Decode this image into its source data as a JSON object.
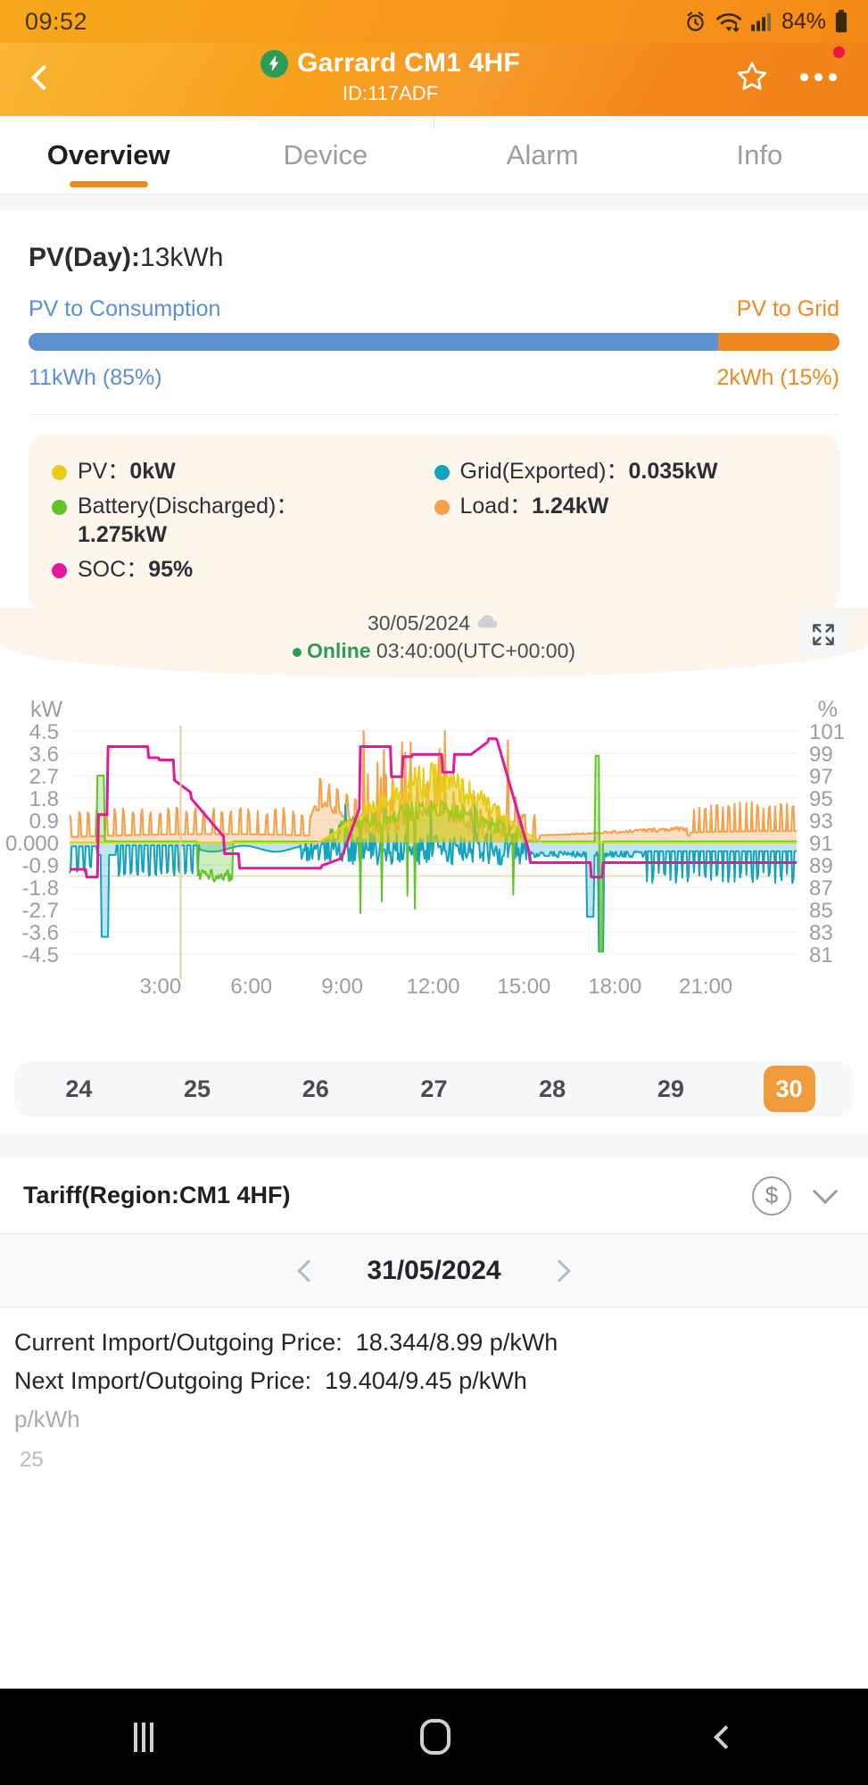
{
  "statusbar": {
    "time": "09:52",
    "battery_pct": "84%",
    "icons": [
      "alarm-icon",
      "wifi-icon",
      "signal-icon",
      "battery-icon"
    ]
  },
  "appbar": {
    "back_icon": "chevron-left-icon",
    "bolt_icon": "⚡",
    "title": "Garrard CM1 4HF",
    "device_id": "ID:117ADF",
    "favorite_icon": "star-outline-icon",
    "more_icon": "more-horizontal-icon",
    "accent": "#f2811a"
  },
  "tabs": [
    {
      "label": "Overview",
      "active": true
    },
    {
      "label": "Device",
      "active": false
    },
    {
      "label": "Alarm",
      "active": false
    },
    {
      "label": "Info",
      "active": false
    }
  ],
  "pv_summary": {
    "title_label": "PV(Day):",
    "title_value": "13kWh",
    "left_label": "PV to Consumption",
    "right_label": "PV to Grid",
    "left_value": "11kWh (85%)",
    "right_value": "2kWh (15%)",
    "left_pct": 85,
    "right_pct": 15,
    "left_color": "#5e90cf",
    "right_color": "#ee8622"
  },
  "legend": {
    "left": [
      {
        "name": "PV",
        "separator": "：",
        "value": "0kW",
        "color": "#e8cc17",
        "dot": "pv-dot"
      },
      {
        "name": "Battery(Discharged)",
        "separator": "：",
        "value": "1.275kW",
        "color": "#63c32c",
        "dot": "battery-dot",
        "wrap": true
      },
      {
        "name": "SOC",
        "separator": "：",
        "value": "95%",
        "color": "#e3189a",
        "dot": "soc-dot"
      }
    ],
    "right": [
      {
        "name": "Grid(Exported)",
        "separator": "：",
        "value": "0.035kW",
        "color": "#13a3bd",
        "dot": "grid-dot"
      },
      {
        "name": "Load",
        "separator": "：",
        "value": "1.24kW",
        "color": "#f5a04a",
        "dot": "load-dot"
      }
    ]
  },
  "status_strip": {
    "date": "30/05/2024",
    "weather_icon": "cloud-icon",
    "status_dot": "online-dot",
    "status": "Online",
    "timestamp": "03:40:00(UTC+00:00)",
    "expand_icon": "expand-fullscreen-icon"
  },
  "chart_data": {
    "type": "line",
    "title": "",
    "xlabel": "",
    "ylabel": "kW",
    "y2label": "%",
    "grid": true,
    "legend_position": "above-chart",
    "ylim": [
      -4.5,
      4.5
    ],
    "y_ticks": [
      "4.5",
      "3.6",
      "2.7",
      "1.8",
      "0.9",
      "0.000",
      "-0.9",
      "-1.8",
      "-2.7",
      "-3.6",
      "-4.5"
    ],
    "y2lim": [
      81,
      101
    ],
    "y2_ticks": [
      "101",
      "99",
      "97",
      "95",
      "93",
      "91",
      "89",
      "87",
      "85",
      "83",
      "81"
    ],
    "x_ticks": [
      "3:00",
      "6:00",
      "9:00",
      "12:00",
      "15:00",
      "18:00",
      "21:00"
    ],
    "x_range": [
      "00:00",
      "24:00"
    ],
    "cursor_time": "03:40",
    "series": [
      {
        "name": "PV",
        "color": "#e8cc17",
        "axis": "left",
        "unit": "kW"
      },
      {
        "name": "Battery(Discharged)",
        "color": "#63c32c",
        "axis": "left",
        "unit": "kW"
      },
      {
        "name": "Grid(Exported)",
        "color": "#13a3bd",
        "axis": "left",
        "unit": "kW"
      },
      {
        "name": "Load",
        "color": "#f5a04a",
        "axis": "left",
        "unit": "kW"
      },
      {
        "name": "SOC",
        "color": "#e3189a",
        "axis": "right",
        "unit": "%"
      }
    ]
  },
  "day_selector": {
    "days": [
      "24",
      "25",
      "26",
      "27",
      "28",
      "29",
      "30"
    ],
    "selected": "30",
    "selected_color": "#f09c3c"
  },
  "tariff": {
    "title": "Tariff(Region:CM1 4HF)",
    "currency_icon": "dollar-circle-icon",
    "collapse_icon": "chevron-down-icon",
    "prev_icon": "chevron-left-icon",
    "next_icon": "chevron-right-icon",
    "date": "31/05/2024",
    "current_price_label": "Current Import/Outgoing Price:",
    "current_price_value": "18.344/8.99 p/kWh",
    "next_price_label": "Next Import/Outgoing Price:",
    "next_price_value": "19.404/9.45 p/kWh",
    "axis_unit": "p/kWh",
    "axis_cut_tick": "25"
  },
  "navbar": {
    "recent_icon": "recent-apps-icon",
    "home_icon": "home-icon",
    "back_icon": "back-icon"
  }
}
